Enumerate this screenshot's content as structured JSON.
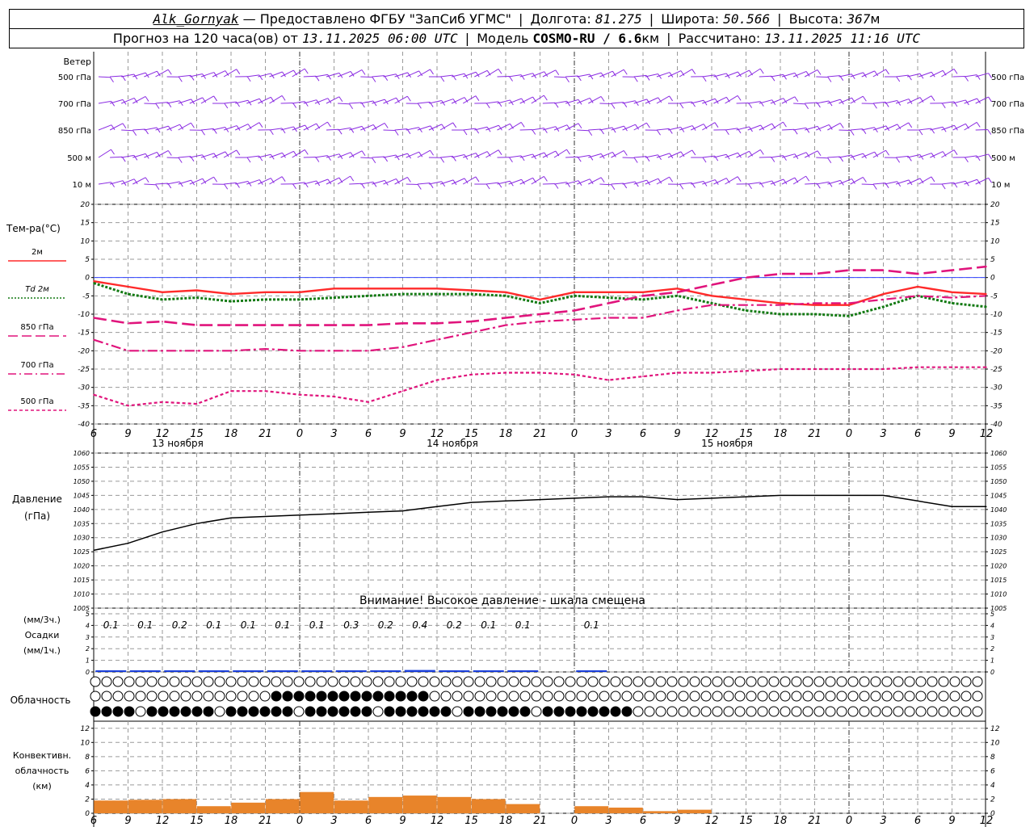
{
  "header": {
    "station": "Alk_Gornyak",
    "provider": "— Предоставлено ФГБУ \"ЗапСиб УГМС\"",
    "lon_label": "Долгота:",
    "lon": "81.275",
    "lat_label": "Широта:",
    "lat": "50.566",
    "alt_label": "Высота:",
    "alt": "367",
    "alt_unit": "м",
    "forecast_label": "Прогноз на 120 часа(ов) от",
    "forecast_time": "13.11.2025 06:00 UTC",
    "model_label": "Модель",
    "model": "COSMO-RU / 6.6",
    "model_unit": "км",
    "calc_label": "Рассчитано:",
    "calc_time": "13.11.2025 11:16 UTC"
  },
  "labels": {
    "wind": "Ветер",
    "wind_levels": [
      "500 гПа",
      "700 гПа",
      "850 гПа",
      "500 м",
      "10  м"
    ],
    "temp_title": "Тем-ра(°C)",
    "temp_legend": [
      "2м",
      "Td  2м",
      "850 гПа",
      "700 гПа",
      "500 гПа"
    ],
    "pressure_title": "Давление",
    "pressure_unit": "(гПа)",
    "pressure_warning": "Внимание! Высокое давление - шкала смещена",
    "precip_3h": "(мм/3ч.)",
    "precip_title": "Осадки",
    "precip_1h": "(мм/1ч.)",
    "cloud_title": "Облачность",
    "conv_title": [
      "Конвективн.",
      "облачность",
      "(км)"
    ],
    "days": [
      "13 ноября",
      "14 ноября",
      "15 ноября"
    ]
  },
  "colors": {
    "t2m": "#ff2a2a",
    "td2m": "#137a13",
    "t850": "#e0147c",
    "t700": "#e0147c",
    "t500": "#e0147c",
    "pressure": "#000000",
    "wind": "#8a2be2",
    "precip": "#1a3fdc",
    "conv": "#e8842a",
    "grid": "#9a9a9a",
    "zero_line": "#3344ff"
  },
  "chart_data": {
    "type": "line",
    "x_hours": [
      6,
      9,
      12,
      15,
      18,
      21,
      0,
      3,
      6,
      9,
      12,
      15,
      18,
      21,
      0,
      3,
      6,
      9,
      12,
      15,
      18,
      21,
      0,
      3,
      6,
      9,
      12
    ],
    "day_labels": [
      "13 ноября",
      "14 ноября",
      "15 ноября"
    ],
    "temperature": {
      "ylabel": "Тем-ра(°C)",
      "ylim": [
        -40,
        20
      ],
      "ticks": [
        20,
        15,
        10,
        5,
        0,
        -5,
        -10,
        -15,
        -20,
        -25,
        -30,
        -35,
        -40
      ],
      "series": [
        {
          "name": "2м",
          "style": "solid",
          "values": [
            -1,
            -2.5,
            -4,
            -3.5,
            -4.5,
            -4,
            -4,
            -3,
            -3,
            -3,
            -3,
            -3.5,
            -4,
            -6,
            -4,
            -4,
            -4,
            -3,
            -5,
            -6,
            -7,
            -7.5,
            -7.5,
            -4.5,
            -2.5,
            -4,
            -4.5
          ]
        },
        {
          "name": "Td  2м",
          "style": "dotted",
          "values": [
            -1.5,
            -4.5,
            -6,
            -5.5,
            -6.5,
            -6,
            -6,
            -5.5,
            -5,
            -4.5,
            -4.5,
            -4.5,
            -5,
            -7,
            -5,
            -5.5,
            -6,
            -5,
            -7,
            -9,
            -10,
            -10,
            -10.5,
            -8,
            -5,
            -7,
            -8
          ]
        },
        {
          "name": "850 гПа",
          "style": "dashed",
          "values": [
            -11,
            -12.5,
            -12,
            -13,
            -13,
            -13,
            -13,
            -13,
            -13,
            -12.5,
            -12.5,
            -12,
            -11,
            -10,
            -9,
            -7,
            -5,
            -4,
            -2,
            0,
            1,
            1,
            2,
            2,
            1,
            2,
            3
          ]
        },
        {
          "name": "700 гПа",
          "style": "dashdot",
          "values": [
            -17,
            -20,
            -20,
            -20,
            -20,
            -19.5,
            -20,
            -20,
            -20,
            -19,
            -17,
            -15,
            -13,
            -12,
            -11.5,
            -11,
            -11,
            -9,
            -7.5,
            -7.5,
            -7.5,
            -7,
            -7,
            -6,
            -5,
            -5.5,
            -5
          ]
        },
        {
          "name": "500 гПа",
          "style": "shortdash",
          "values": [
            -32,
            -35,
            -34,
            -34.5,
            -31,
            -31,
            -32,
            -32.5,
            -34,
            -31,
            -28,
            -26.5,
            -26,
            -26,
            -26.5,
            -28,
            -27,
            -26,
            -26,
            -25.5,
            -25,
            -25,
            -25,
            -25,
            -24.5,
            -24.5,
            -24.5
          ]
        }
      ]
    },
    "pressure": {
      "ylabel": "Давление (гПа)",
      "ylim": [
        1005,
        1060
      ],
      "ticks": [
        1060,
        1055,
        1050,
        1045,
        1040,
        1035,
        1030,
        1025,
        1020,
        1015,
        1010,
        1005
      ],
      "values": [
        1025.5,
        1028,
        1032,
        1035,
        1037,
        1037.5,
        1038,
        1038.5,
        1039,
        1039.5,
        1041,
        1042.5,
        1043,
        1043.5,
        1044,
        1044.5,
        1044.5,
        1043.5,
        1044,
        1044.5,
        1045,
        1045,
        1045,
        1045,
        1043,
        1041,
        1041
      ]
    },
    "precipitation": {
      "ylim": [
        0,
        5
      ],
      "ticks": [
        5,
        4,
        3,
        2,
        1,
        0
      ],
      "labels_3h": [
        "0.1",
        "0.1",
        "0.2",
        "0.1",
        "0.1",
        "0.1",
        "0.1",
        "0.3",
        "0.2",
        "0.4",
        "0.2",
        "0.1",
        "0.1",
        "",
        "0.1"
      ],
      "values_3h": [
        0.1,
        0.1,
        0.2,
        0.1,
        0.1,
        0.1,
        0.1,
        0.3,
        0.2,
        0.4,
        0.2,
        0.1,
        0.1,
        0,
        0.1
      ]
    },
    "convective_cloud_km": {
      "ylim": [
        0,
        13
      ],
      "ticks": [
        12,
        10,
        8,
        6,
        4,
        2,
        0
      ],
      "values": [
        1.8,
        1.9,
        2.0,
        1.0,
        1.5,
        2.0,
        3.0,
        1.8,
        2.3,
        2.5,
        2.3,
        2.0,
        1.3,
        0,
        1.0,
        0.8,
        0.3,
        0.5,
        0,
        0,
        0,
        0,
        0,
        0,
        0,
        0,
        0
      ]
    }
  }
}
